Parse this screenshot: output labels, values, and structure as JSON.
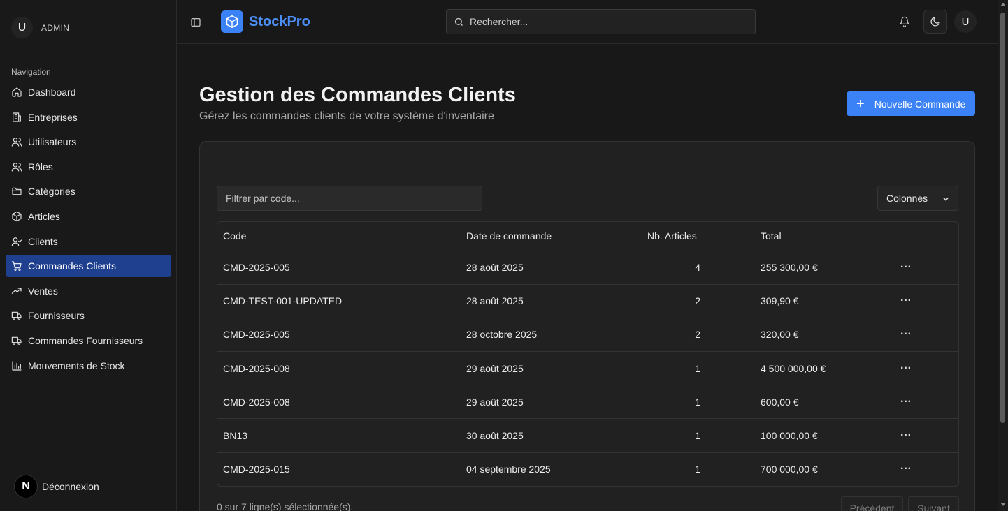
{
  "user": {
    "initial": "U",
    "name": "ADMIN"
  },
  "nav": {
    "section": "Navigation",
    "items": [
      {
        "label": "Dashboard",
        "icon": "home-icon"
      },
      {
        "label": "Entreprises",
        "icon": "building-icon"
      },
      {
        "label": "Utilisateurs",
        "icon": "users-icon"
      },
      {
        "label": "Rôles",
        "icon": "users-icon"
      },
      {
        "label": "Catégories",
        "icon": "folder-icon"
      },
      {
        "label": "Articles",
        "icon": "box-icon"
      },
      {
        "label": "Clients",
        "icon": "user-check-icon"
      },
      {
        "label": "Commandes Clients",
        "icon": "cart-icon",
        "active": true
      },
      {
        "label": "Ventes",
        "icon": "trend-up-icon"
      },
      {
        "label": "Fournisseurs",
        "icon": "truck-icon"
      },
      {
        "label": "Commandes Fournisseurs",
        "icon": "truck-icon"
      },
      {
        "label": "Mouvements de Stock",
        "icon": "bar-chart-icon"
      }
    ],
    "logout": "Déconnexion",
    "logout_logo": "N"
  },
  "header": {
    "brand": "StockPro",
    "search_placeholder": "Rechercher...",
    "avatar": "U"
  },
  "page": {
    "title": "Gestion des Commandes Clients",
    "subtitle": "Gérez les commandes clients de votre système d'inventaire",
    "new_button": "Nouvelle Commande",
    "new_button_icon": "+"
  },
  "table": {
    "filter_placeholder": "Filtrer par code...",
    "columns_button": "Colonnes",
    "headers": {
      "code": "Code",
      "date": "Date de commande",
      "nb": "Nb. Articles",
      "total": "Total"
    },
    "rows": [
      {
        "code": "CMD-2025-005",
        "date": "28 août 2025",
        "nb": "4",
        "total": "255 300,00 €",
        "actions": "···"
      },
      {
        "code": "CMD-TEST-001-UPDATED",
        "date": "28 août 2025",
        "nb": "2",
        "total": "309,90 €",
        "actions": "···"
      },
      {
        "code": "CMD-2025-005",
        "date": "28 octobre 2025",
        "nb": "2",
        "total": "320,00 €",
        "actions": "···"
      },
      {
        "code": "CMD-2025-008",
        "date": "29 août 2025",
        "nb": "1",
        "total": "4 500 000,00 €",
        "actions": "···"
      },
      {
        "code": "CMD-2025-008",
        "date": "29 août 2025",
        "nb": "1",
        "total": "600,00 €",
        "actions": "···"
      },
      {
        "code": "BN13",
        "date": "30 août 2025",
        "nb": "1",
        "total": "100 000,00 €",
        "actions": "···"
      },
      {
        "code": "CMD-2025-015",
        "date": "04 septembre 2025",
        "nb": "1",
        "total": "700 000,00 €",
        "actions": "···"
      }
    ],
    "selection_text": "0 sur 7 ligne(s) sélectionnée(s).",
    "prev": "Précédent",
    "next": "Suivant"
  },
  "colors": {
    "accent": "#3b82f6",
    "active_nav": "#1f3f8f",
    "background": "#181818"
  }
}
